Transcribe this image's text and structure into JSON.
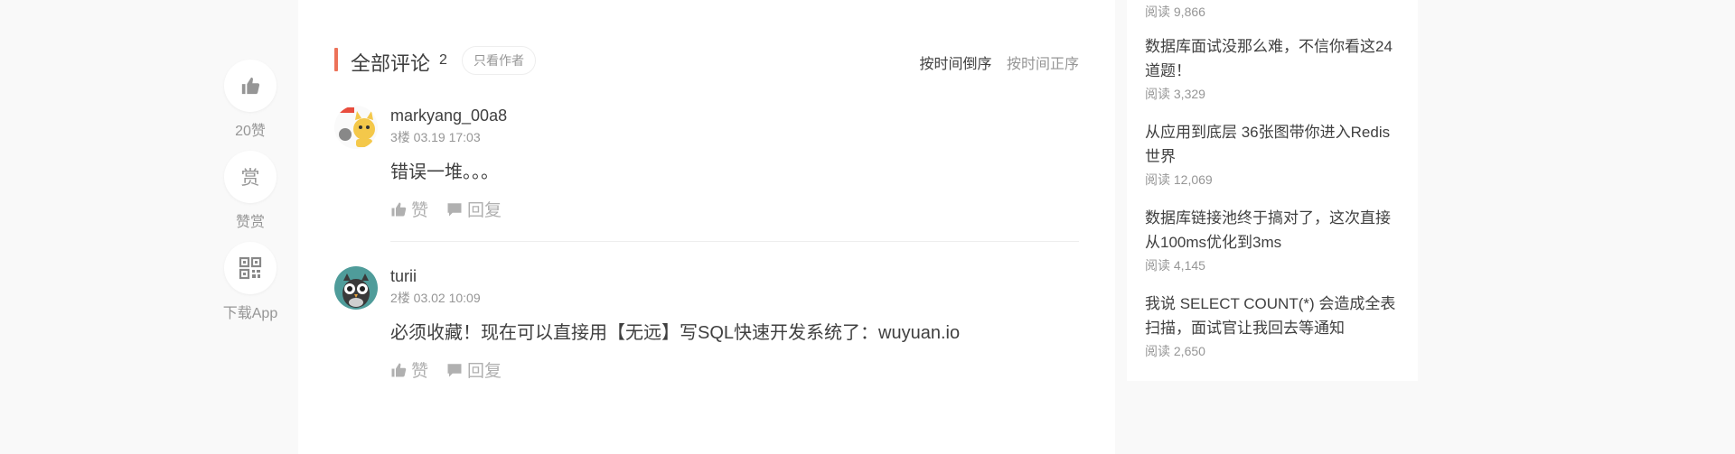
{
  "rail": {
    "like_label": "20赞",
    "reward_icon_text": "赏",
    "reward_label": "赞赏",
    "download_label": "下载App"
  },
  "comments_header": {
    "title": "全部评论",
    "count": "2",
    "author_only": "只看作者",
    "sort_desc": "按时间倒序",
    "sort_asc": "按时间正序"
  },
  "comments": [
    {
      "name": "markyang_00a8",
      "meta": "3楼 03.19 17:03",
      "text": "错误一堆。。。",
      "like": "赞",
      "reply": "回复"
    },
    {
      "name": "turii",
      "meta": "2楼 03.02 10:09",
      "text": "必须收藏！现在可以直接用【无远】写SQL快速开发系统了：wuyuan.io",
      "like": "赞",
      "reply": "回复"
    }
  ],
  "sidebar": {
    "top_read": "阅读 9,866",
    "articles": [
      {
        "title": "数据库面试没那么难，不信你看这24道题！",
        "read": "阅读 3,329"
      },
      {
        "title": "从应用到底层 36张图带你进入Redis世界",
        "read": "阅读 12,069"
      },
      {
        "title": "数据库链接池终于搞对了，这次直接从100ms优化到3ms",
        "read": "阅读 4,145"
      },
      {
        "title": "我说 SELECT COUNT(*) 会造成全表扫描，面试官让我回去等通知",
        "read": "阅读 2,650"
      }
    ]
  },
  "colors": {
    "accent": "#ec7259",
    "muted": "#969696",
    "text": "#404040"
  }
}
